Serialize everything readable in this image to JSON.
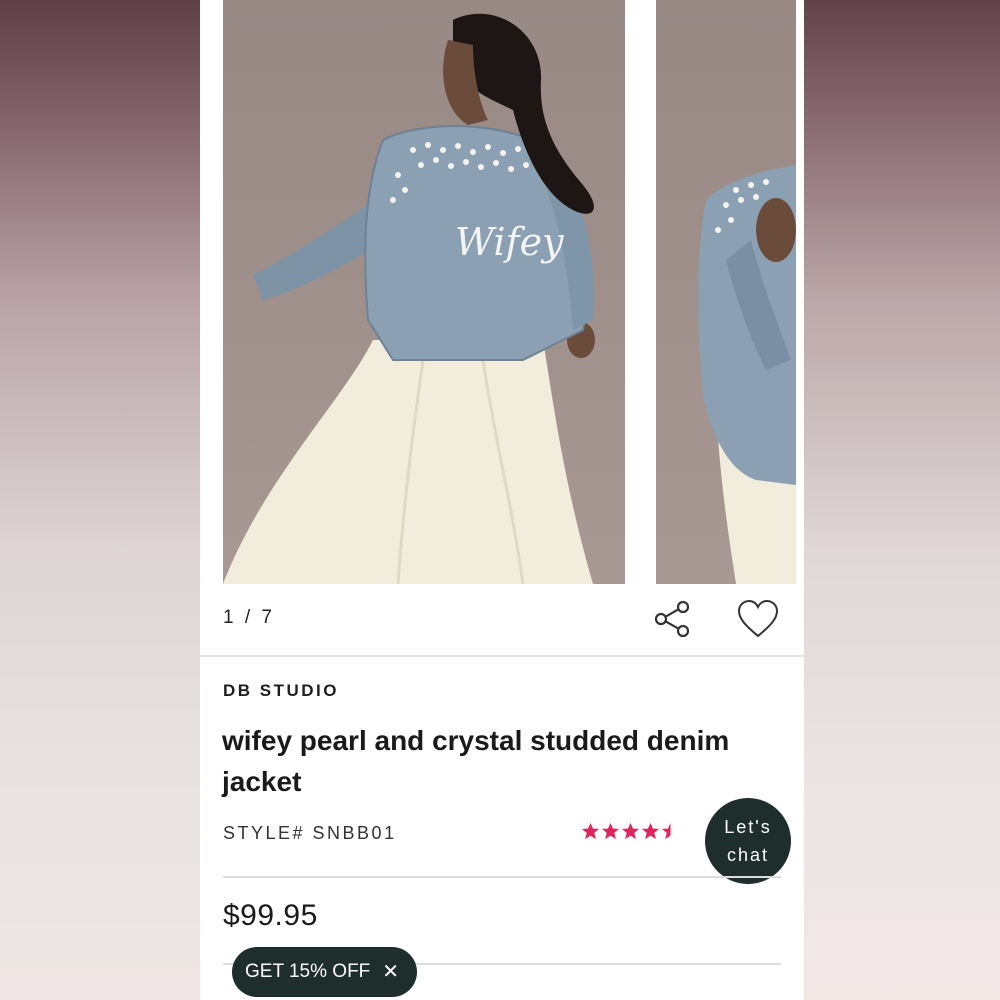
{
  "gallery": {
    "counter": "1 / 7",
    "photo_main_text": "Wifey"
  },
  "product": {
    "brand": "DB STUDIO",
    "title": "wifey pearl and crystal studded denim jacket",
    "style_number": "STYLE# SNBB01",
    "rating": 4.5,
    "rating_max": 5,
    "price": "$99.95"
  },
  "chat": {
    "label_line1": "Let's",
    "label_line2": "chat"
  },
  "promo": {
    "label": "GET 15% OFF",
    "close": "✕"
  },
  "colors": {
    "accent_star": "#e0245e",
    "dark": "#1e2e2d"
  },
  "icons": {
    "share": "share-icon",
    "favorite": "heart-icon",
    "close": "close-icon"
  }
}
